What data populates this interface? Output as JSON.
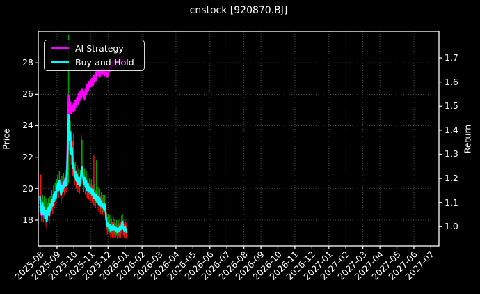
{
  "title": "cnstock [920870.BJ]",
  "colors": {
    "background": "#000000",
    "ai_strategy": "#ff00ff",
    "buy_and_hold": "#00ffff",
    "bar_up": "#00a000",
    "bar_down": "#f01010",
    "axis": "#ffffff",
    "grid": "rgba(255,255,255,0.4)"
  },
  "legend": {
    "items": [
      {
        "label": "AI Strategy",
        "color": "#ff00ff"
      },
      {
        "label": "Buy-and-Hold",
        "color": "#00ffff"
      }
    ]
  },
  "axes": {
    "left_label": "Price",
    "right_label": "Return",
    "price_ticks": [
      18,
      20,
      22,
      24,
      26,
      28
    ],
    "return_ticks": [
      "1.0",
      "1.1",
      "1.2",
      "1.3",
      "1.4",
      "1.5",
      "1.6",
      "1.7"
    ],
    "x_ticks": [
      "2025-08",
      "2025-09",
      "2025-10",
      "2025-11",
      "2025-12",
      "2026-01",
      "2026-02",
      "2026-03",
      "2026-04",
      "2026-05",
      "2026-06",
      "2026-07",
      "2026-08",
      "2026-09",
      "2026-10",
      "2026-11",
      "2026-12",
      "2027-01",
      "2027-02",
      "2027-03",
      "2027-04",
      "2027-05",
      "2027-06",
      "2027-07"
    ]
  },
  "chart_data": {
    "type": "line",
    "title": "cnstock [920870.BJ]",
    "xlabel": "",
    "ylabel_left": "Price",
    "ylabel_right": "Return",
    "price_ylim": [
      16.36,
      30.0
    ],
    "return_ylim": [
      0.92,
      1.81
    ],
    "x_tick_labels": [
      "2025-08",
      "2025-09",
      "2025-10",
      "2025-11",
      "2025-12",
      "2026-01",
      "2026-02",
      "2026-03",
      "2026-04",
      "2026-05",
      "2026-06",
      "2026-07",
      "2026-08",
      "2026-09",
      "2026-10",
      "2026-11",
      "2026-12",
      "2027-01",
      "2027-02",
      "2027-03",
      "2027-04",
      "2027-05",
      "2027-06",
      "2027-07"
    ],
    "grid": true,
    "legend_position": "upper-left",
    "data_month_span": [
      0,
      5.1
    ],
    "series": [
      {
        "name": "AI Strategy",
        "color": "#ff00ff",
        "values": [
          18.9,
          18.6,
          18.3,
          18.9,
          18.3,
          18.7,
          18.2,
          18.5,
          18.0,
          18.4,
          18.7,
          18.4,
          18.9,
          18.7,
          19.2,
          19.0,
          19.5,
          19.3,
          19.7,
          19.5,
          19.9,
          20.2,
          20.0,
          20.4,
          20.1,
          19.8,
          20.3,
          20.0,
          20.5,
          20.2,
          20.7,
          20.4,
          21.0,
          23.5,
          25.9,
          24.9,
          25.5,
          24.8,
          25.3,
          24.9,
          25.4,
          25.0,
          25.6,
          25.2,
          25.8,
          25.4,
          26.0,
          25.6,
          26.2,
          25.8,
          26.3,
          25.9,
          26.1,
          25.7,
          26.3,
          26.0,
          26.6,
          26.2,
          26.8,
          26.4,
          26.9,
          26.5,
          27.0,
          26.6,
          27.2,
          26.8,
          27.4,
          26.9,
          27.6,
          27.2,
          27.5,
          27.1,
          27.4,
          27.6,
          27.3,
          27.6,
          27.4,
          27.2,
          27.5,
          27.3,
          27.1,
          27.4,
          27.7,
          27.5,
          28.0,
          27.7,
          28.1,
          27.8,
          28.2,
          27.9,
          28.1,
          27.8,
          28.0,
          28.2,
          27.9,
          28.1,
          28.3,
          28.0,
          28.2,
          28.0,
          28.1,
          27.9,
          28.1,
          28.0
        ]
      },
      {
        "name": "Buy-and-Hold",
        "color": "#00ffff",
        "values": [
          19.5,
          18.7,
          18.4,
          19.1,
          18.4,
          18.8,
          18.1,
          18.6,
          17.9,
          18.5,
          18.8,
          18.3,
          19.0,
          18.6,
          19.3,
          18.9,
          19.6,
          19.2,
          19.8,
          19.4,
          20.0,
          20.3,
          19.9,
          20.5,
          20.0,
          19.6,
          20.2,
          19.8,
          20.4,
          20.1,
          20.6,
          20.2,
          20.9,
          22.6,
          24.7,
          23.1,
          23.6,
          22.2,
          22.6,
          21.3,
          21.6,
          20.7,
          21.1,
          20.5,
          20.9,
          20.3,
          20.7,
          20.2,
          20.6,
          21.0,
          21.4,
          20.8,
          20.3,
          20.7,
          20.1,
          20.5,
          19.9,
          20.3,
          19.8,
          20.1,
          19.7,
          20.0,
          19.6,
          19.9,
          19.4,
          19.7,
          19.3,
          19.6,
          19.1,
          19.5,
          19.0,
          19.4,
          18.9,
          19.2,
          18.8,
          19.0,
          18.7,
          19.0,
          18.5,
          17.9,
          17.6,
          17.8,
          17.5,
          17.7,
          17.3,
          17.6,
          17.4,
          17.7,
          17.4,
          17.6,
          17.3,
          17.5,
          17.2,
          17.5,
          17.3,
          17.6,
          17.4,
          17.7,
          17.9,
          17.5,
          17.3,
          17.6,
          17.4,
          17.2
        ]
      }
    ],
    "highlow_bars": {
      "high": [
        20.0,
        20.9,
        18.8,
        19.6,
        19.0,
        19.5,
        18.6,
        19.4,
        18.4,
        19.1,
        19.4,
        18.9,
        19.5,
        19.2,
        19.9,
        19.4,
        20.2,
        19.7,
        20.4,
        19.9,
        20.6,
        20.9,
        20.4,
        21.1,
        20.6,
        20.2,
        20.8,
        20.3,
        21.0,
        20.6,
        21.2,
        20.8,
        21.5,
        23.2,
        29.8,
        25.0,
        24.3,
        23.7,
        23.2,
        23.0,
        23.5,
        21.5,
        21.7,
        21.2,
        21.5,
        20.9,
        21.3,
        20.8,
        21.2,
        23.4,
        23.1,
        21.4,
        20.9,
        21.3,
        20.7,
        21.1,
        20.5,
        20.9,
        20.4,
        20.7,
        20.3,
        20.6,
        20.2,
        20.5,
        22.1,
        20.3,
        19.9,
        21.8,
        19.7,
        20.1,
        19.6,
        20.0,
        19.5,
        19.8,
        19.4,
        19.6,
        19.3,
        19.6,
        19.1,
        18.5,
        18.2,
        18.4,
        18.0,
        18.3,
        17.8,
        18.1,
        17.9,
        18.3,
        17.9,
        18.1,
        17.8,
        18.0,
        17.7,
        18.0,
        17.8,
        18.1,
        17.9,
        18.3,
        18.4,
        18.0,
        17.8,
        18.1,
        17.9,
        17.7
      ],
      "low": [
        19.0,
        18.3,
        17.9,
        18.6,
        17.9,
        18.4,
        17.6,
        18.1,
        17.5,
        18.0,
        18.4,
        17.8,
        18.5,
        18.2,
        18.8,
        18.4,
        19.1,
        18.8,
        19.3,
        19.0,
        19.5,
        19.8,
        19.4,
        20.0,
        19.6,
        19.1,
        19.7,
        19.4,
        19.9,
        19.6,
        20.1,
        19.8,
        20.4,
        20.2,
        20.4,
        22.4,
        23.0,
        21.5,
        22.0,
        20.8,
        21.0,
        20.2,
        20.5,
        20.0,
        20.4,
        19.8,
        20.2,
        19.7,
        20.1,
        20.3,
        20.6,
        20.3,
        19.8,
        20.2,
        19.6,
        20.0,
        19.4,
        19.8,
        19.3,
        19.6,
        19.2,
        19.5,
        19.1,
        19.4,
        18.9,
        19.2,
        18.8,
        19.1,
        18.6,
        19.0,
        18.5,
        18.9,
        18.4,
        18.7,
        18.3,
        18.5,
        18.2,
        18.5,
        18.0,
        17.4,
        17.1,
        17.3,
        17.0,
        17.2,
        16.9,
        17.1,
        16.9,
        17.2,
        16.9,
        17.1,
        16.9,
        17.0,
        16.8,
        17.0,
        16.9,
        17.1,
        16.9,
        17.2,
        17.4,
        17.0,
        16.9,
        17.1,
        16.9,
        16.8
      ]
    }
  }
}
